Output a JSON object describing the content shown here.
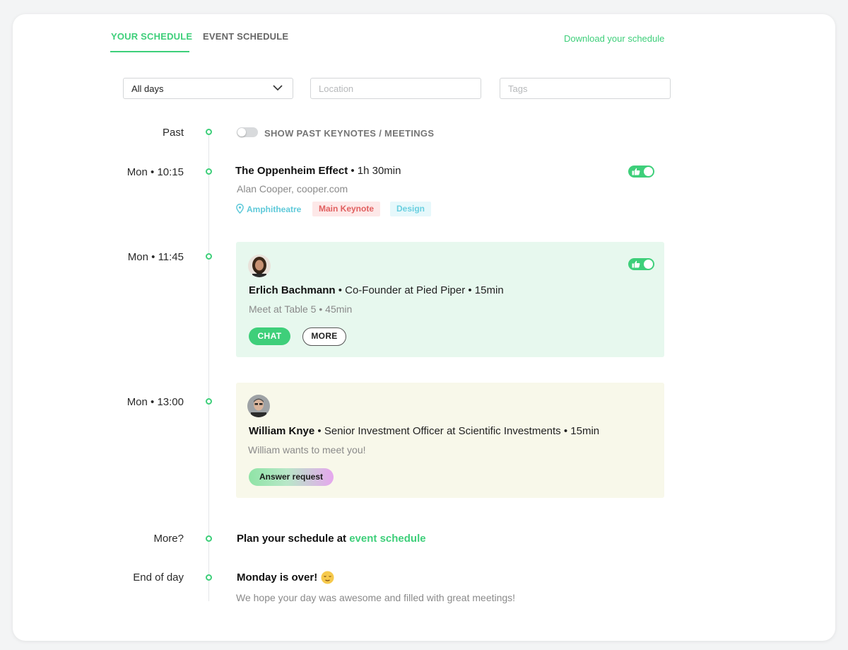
{
  "tabs": [
    {
      "label": "YOUR SCHEDULE",
      "active": true
    },
    {
      "label": "EVENT SCHEDULE",
      "active": false
    }
  ],
  "download_link": "Download your schedule",
  "filters": {
    "days": {
      "value": "All days"
    },
    "location": {
      "placeholder": "Location"
    },
    "tags": {
      "placeholder": "Tags"
    }
  },
  "past": {
    "time": "Past",
    "toggle_label": "SHOW PAST KEYNOTES / MEETINGS",
    "toggle_on": false
  },
  "events": [
    {
      "time": "Mon • 10:15",
      "title": "The Oppenheim Effect",
      "duration": " • 1h 30min",
      "speaker": "Alan Cooper, cooper.com",
      "location": "Amphitheatre",
      "tags": [
        "Main Keynote",
        "Design"
      ],
      "liked": true
    },
    {
      "time": "Mon • 11:45",
      "name": "Erlich Bachmann",
      "detail": " • Co-Founder at Pied Piper • 15min",
      "sub": "Meet at Table 5 • 45min",
      "buttons": {
        "chat": "CHAT",
        "more": "MORE"
      },
      "liked": true
    },
    {
      "time": "Mon • 13:00",
      "name": "William Knye",
      "detail": " • Senior Investment Officer at Scientific Investments • 15min",
      "sub": "William wants to meet you!",
      "button": "Answer request"
    }
  ],
  "more": {
    "time": "More?",
    "text": "Plan your schedule at ",
    "link": "event schedule"
  },
  "end_of_day": {
    "time": "End of day",
    "title": "Monday is over!",
    "emoji": "relieved-face-icon",
    "sub": "We hope your day was awesome and filled with great meetings!"
  },
  "colors": {
    "accent": "#3ecf7a",
    "keynote_tag": "#e15f5f",
    "design_tag": "#69cfe0",
    "meeting_card": "#e7f8ee",
    "request_card": "#f8f8ea"
  }
}
